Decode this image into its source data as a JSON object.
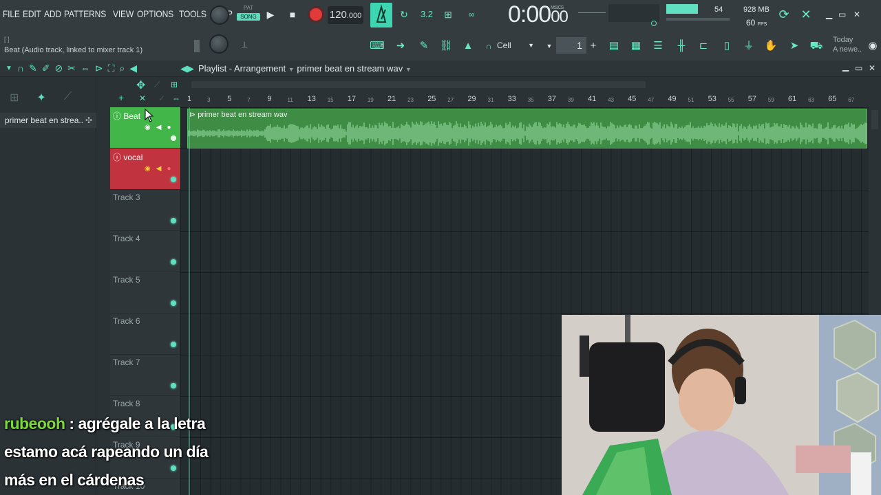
{
  "menu": [
    "FILE",
    "EDIT",
    "ADD",
    "PATTERNS",
    "VIEW",
    "OPTIONS",
    "TOOLS",
    "HELP"
  ],
  "hint_box": "[ ]",
  "hint": "Beat (Audio track, linked to mixer track 1)",
  "transport": {
    "pat_label": "PAT",
    "song_label": "SONG",
    "tempo_main": "120",
    "tempo_decimal": ".000",
    "time": "0:00",
    "time_frac": "00",
    "time_unit": "M:S:CS",
    "bpm_pattern": "3.2"
  },
  "meters": {
    "cpu": "54",
    "memory": "928 MB",
    "fps_value": "60",
    "fps_label": "FPS"
  },
  "toolbar": {
    "snap": "Cell",
    "pattern_number": "1"
  },
  "news": {
    "date": "Today",
    "text": "A newe.."
  },
  "playlist": {
    "title": "Playlist - Arrangement",
    "separator": "›",
    "clip_name": "primer beat en stream wav"
  },
  "left_panel": {
    "clip_item": "primer beat en strea.."
  },
  "tracks": [
    {
      "name": "Beat",
      "color": "#43b649"
    },
    {
      "name": "vocal",
      "color": "#c0333f"
    },
    {
      "name": "Track 3"
    },
    {
      "name": "Track 4"
    },
    {
      "name": "Track 5"
    },
    {
      "name": "Track 6"
    },
    {
      "name": "Track 7"
    },
    {
      "name": "Track 8"
    },
    {
      "name": "Track 9"
    },
    {
      "name": "Track 10"
    }
  ],
  "ruler": {
    "bars": [
      "1",
      "3",
      "5",
      "7",
      "9",
      "11",
      "13",
      "15",
      "17",
      "19",
      "21",
      "23",
      "25",
      "27",
      "29",
      "31",
      "33",
      "35",
      "37",
      "39",
      "41",
      "43",
      "45",
      "47",
      "49",
      "51",
      "53",
      "55",
      "57",
      "59",
      "61",
      "63",
      "65",
      "67"
    ]
  },
  "chat": {
    "user": "rubeooh",
    "line1": "agrégale a la letra",
    "line2": "estamo acá rapeando un día",
    "line3": "más en el cárdenas"
  },
  "colors": {
    "accent": "#5fe0c0",
    "record": "#e13a3a",
    "beat_track": "#43b649",
    "vocal_track": "#c0333f",
    "chat_user": "#7cd93a"
  }
}
